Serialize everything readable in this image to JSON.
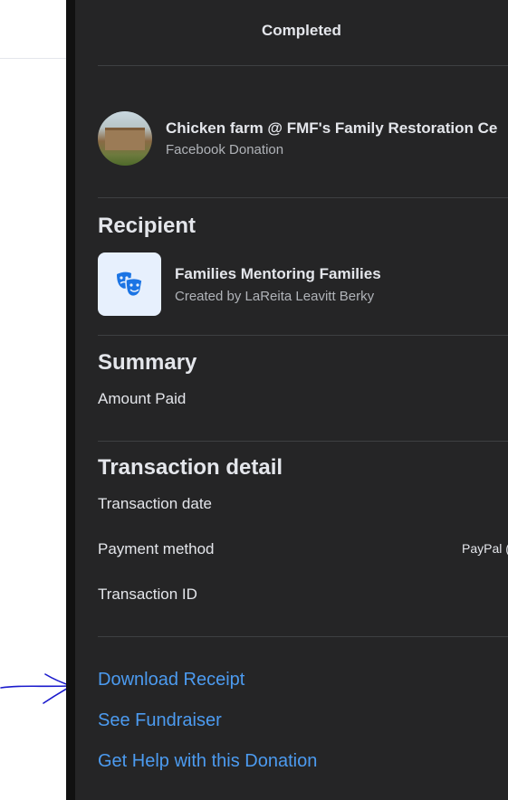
{
  "status": "Completed",
  "fundraiser": {
    "title": "Chicken farm @ FMF's Family Restoration Ce",
    "subtitle": "Facebook Donation"
  },
  "recipient": {
    "heading": "Recipient",
    "name": "Families Mentoring Families",
    "created_by": "Created by LaReita Leavitt Berky",
    "icon": "theater-masks-icon"
  },
  "summary": {
    "heading": "Summary",
    "amount_label": "Amount Paid"
  },
  "transaction": {
    "heading": "Transaction detail",
    "date_label": "Transaction date",
    "payment_label": "Payment method",
    "payment_value": "PayPal (",
    "id_label": "Transaction ID"
  },
  "links": {
    "download": "Download Receipt",
    "fundraiser": "See Fundraiser",
    "help": "Get Help with this Donation"
  },
  "annotation": "hand-drawn-arrow",
  "colors": {
    "panel_bg": "#252526",
    "link": "#4c9bf0",
    "annotation": "#1a1acc"
  }
}
